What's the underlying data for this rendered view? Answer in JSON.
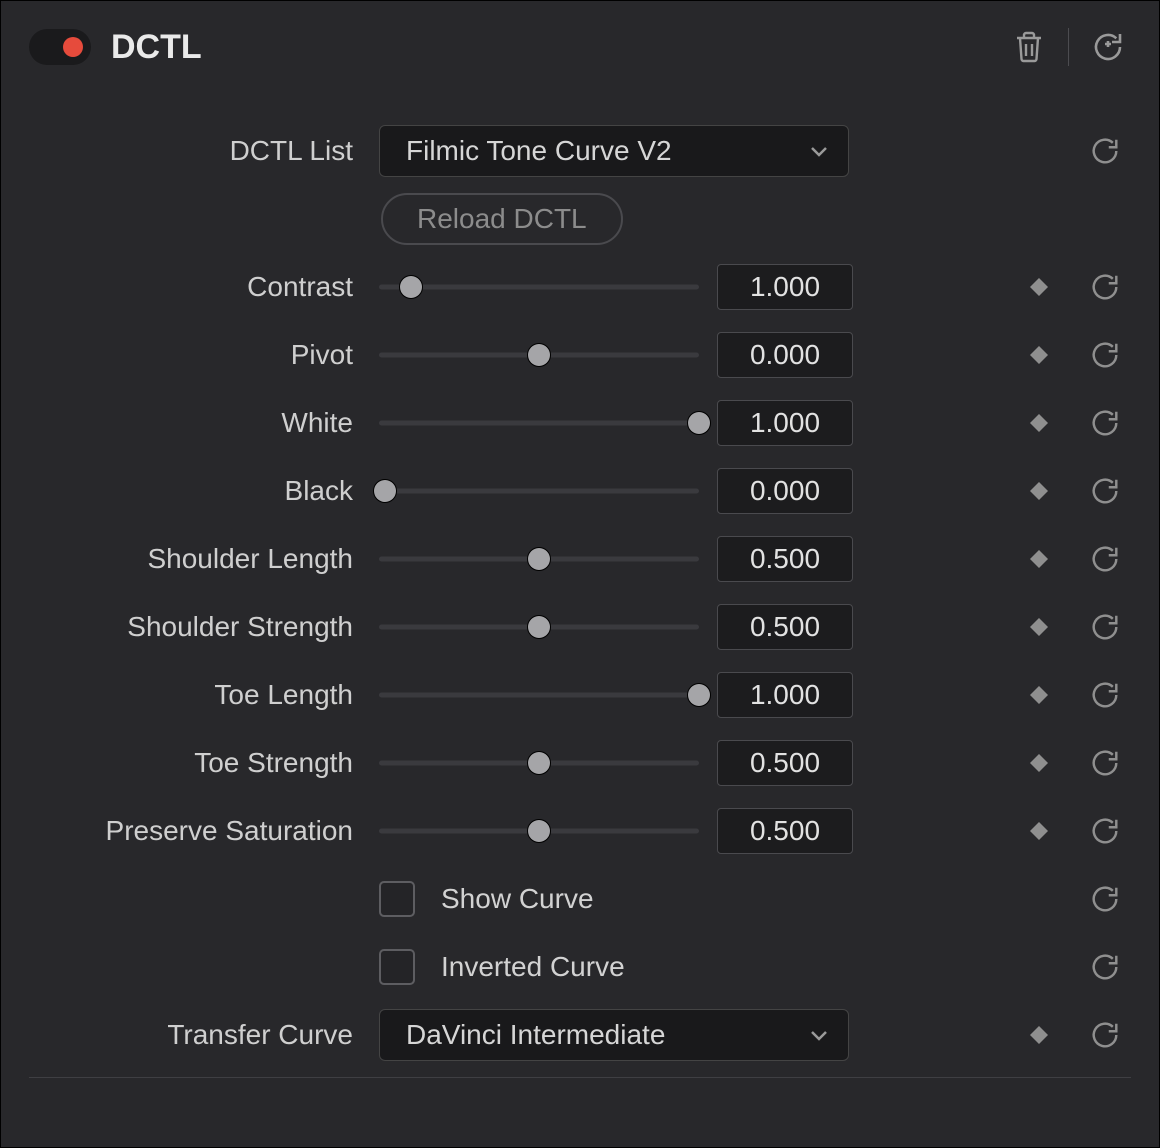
{
  "header": {
    "title": "DCTL",
    "enabled": true
  },
  "dctl_list": {
    "label": "DCTL List",
    "value": "Filmic Tone Curve V2"
  },
  "reload_button": "Reload DCTL",
  "sliders": [
    {
      "label": "Contrast",
      "value": "1.000",
      "pos": 0.1
    },
    {
      "label": "Pivot",
      "value": "0.000",
      "pos": 0.5
    },
    {
      "label": "White",
      "value": "1.000",
      "pos": 1.0
    },
    {
      "label": "Black",
      "value": "0.000",
      "pos": 0.02
    },
    {
      "label": "Shoulder Length",
      "value": "0.500",
      "pos": 0.5
    },
    {
      "label": "Shoulder Strength",
      "value": "0.500",
      "pos": 0.5
    },
    {
      "label": "Toe Length",
      "value": "1.000",
      "pos": 1.0
    },
    {
      "label": "Toe Strength",
      "value": "0.500",
      "pos": 0.5
    },
    {
      "label": "Preserve Saturation",
      "value": "0.500",
      "pos": 0.5
    }
  ],
  "checkboxes": [
    {
      "label": "Show Curve",
      "checked": false
    },
    {
      "label": "Inverted Curve",
      "checked": false
    }
  ],
  "transfer_curve": {
    "label": "Transfer Curve",
    "value": "DaVinci Intermediate"
  },
  "icons": {
    "trash": "trash-icon",
    "reset_circle": "reset-circle-icon",
    "keyframe": "keyframe-diamond-icon",
    "chevron": "chevron-down-icon"
  }
}
